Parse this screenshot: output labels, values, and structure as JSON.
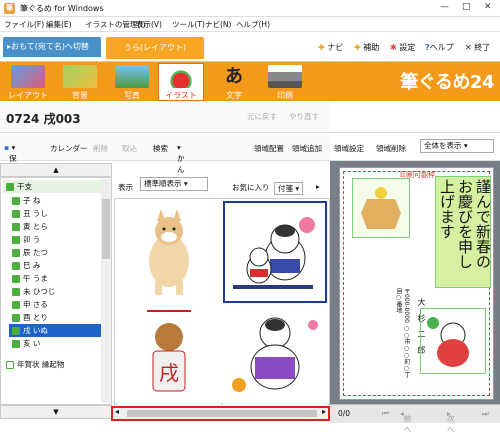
{
  "window": {
    "title": "筆ぐるめ for Windows",
    "app_icon": "筆",
    "min": "—",
    "max": "□",
    "close": "✕"
  },
  "menu": [
    "ファイル(F)",
    "編集(E)",
    "イラストの管理(I)",
    "表示(V)",
    "ツール(T)",
    "ナビ(N)",
    "ヘルプ(H)"
  ],
  "mode_tabs": {
    "front": "▸おもて(宛て名)へ切替",
    "back": "うら(レイアウト)"
  },
  "top_right": {
    "navi": "ナビ",
    "hosoku": "補助",
    "settings": "設定",
    "help": "ヘルプ",
    "exit": "終了"
  },
  "ribbon": {
    "buttons": [
      "レイアウト",
      "背景",
      "写真",
      "イラスト",
      "文字",
      "印刷"
    ],
    "selected": "イラスト",
    "logo": "筆ぐるめ24",
    "accent": "#f39a1b"
  },
  "address": {
    "name": "0724 戌003",
    "undo": "元に戻す",
    "redo": "やり直す"
  },
  "toolbar": {
    "save": "保存",
    "calendar": "カレンダー",
    "delete": "削除",
    "capture": "取込",
    "search": "検索",
    "simple_layout": "かんたんレイアウト",
    "region_place": "領域配置",
    "region_add": "領域追加"
  },
  "right_toolbar": {
    "region_set": "領域設定",
    "region_delete": "領域削除",
    "zoom": "全体を表示"
  },
  "categories": {
    "header": "干支",
    "items": [
      "子 ね",
      "丑 うし",
      "寅 とら",
      "卯 う",
      "辰 たつ",
      "巳 み",
      "午 うま",
      "未 ひつじ",
      "申 さる",
      "酉 とり",
      "戌 いぬ",
      "亥 い"
    ],
    "selected": "戌 いぬ",
    "next_group": "年賀状 縁起物"
  },
  "filter": {
    "display_label": "表示",
    "sort": "標準順表示",
    "favorites": "お気に入り",
    "attach": "付箋"
  },
  "card": {
    "print_area": "印刷可能枠",
    "greeting": "謹んで新春のお慶びを申し上げます",
    "address_lines": [
      "〒000-0000",
      "○○市○○町○丁目○番地"
    ],
    "family": [
      "大",
      "杉",
      "二",
      "郎"
    ]
  },
  "pagebar": {
    "page": "0/0",
    "prev": "前へ",
    "next": "次へ"
  }
}
